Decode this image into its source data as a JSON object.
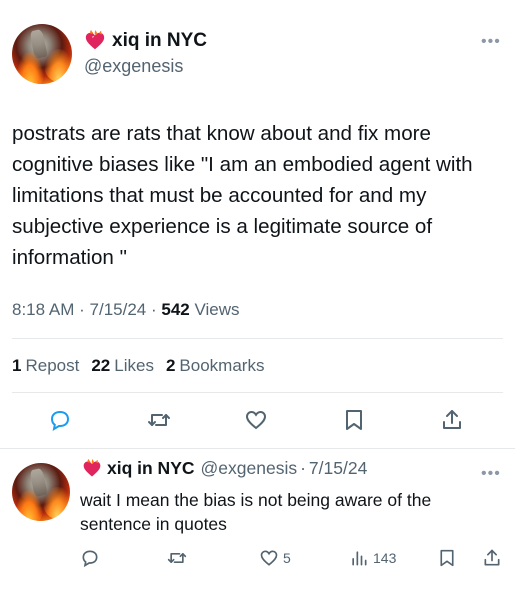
{
  "main_tweet": {
    "display_name": "xiq in NYC",
    "handle": "@exgenesis",
    "text": "postrats are rats that know about and fix more cognitive biases like \"I am an embodied agent with limitations that must be accounted for and my subjective experience is a legitimate source of information \"",
    "time": "8:18 AM",
    "date": "7/15/24",
    "views_count": "542",
    "views_label": "Views",
    "reposts_count": "1",
    "reposts_label": "Repost",
    "likes_count": "22",
    "likes_label": "Likes",
    "bookmarks_count": "2",
    "bookmarks_label": "Bookmarks"
  },
  "reply": {
    "display_name": "xiq in NYC",
    "handle": "@exgenesis",
    "date": "7/15/24",
    "text": "wait I mean the bias is not being aware of the sentence in quotes",
    "likes_count": "5",
    "views_count": "143"
  },
  "separator": "·",
  "icons": {
    "name_badge": "flaming-heart-icon",
    "more": "more-horizontal-icon",
    "reply": "reply-icon",
    "repost": "repost-icon",
    "like": "like-icon",
    "bookmark": "bookmark-icon",
    "share": "share-icon",
    "views": "views-icon"
  },
  "colors": {
    "text": "#0f1419",
    "secondary": "#536471",
    "divider": "#e6e8ea"
  }
}
